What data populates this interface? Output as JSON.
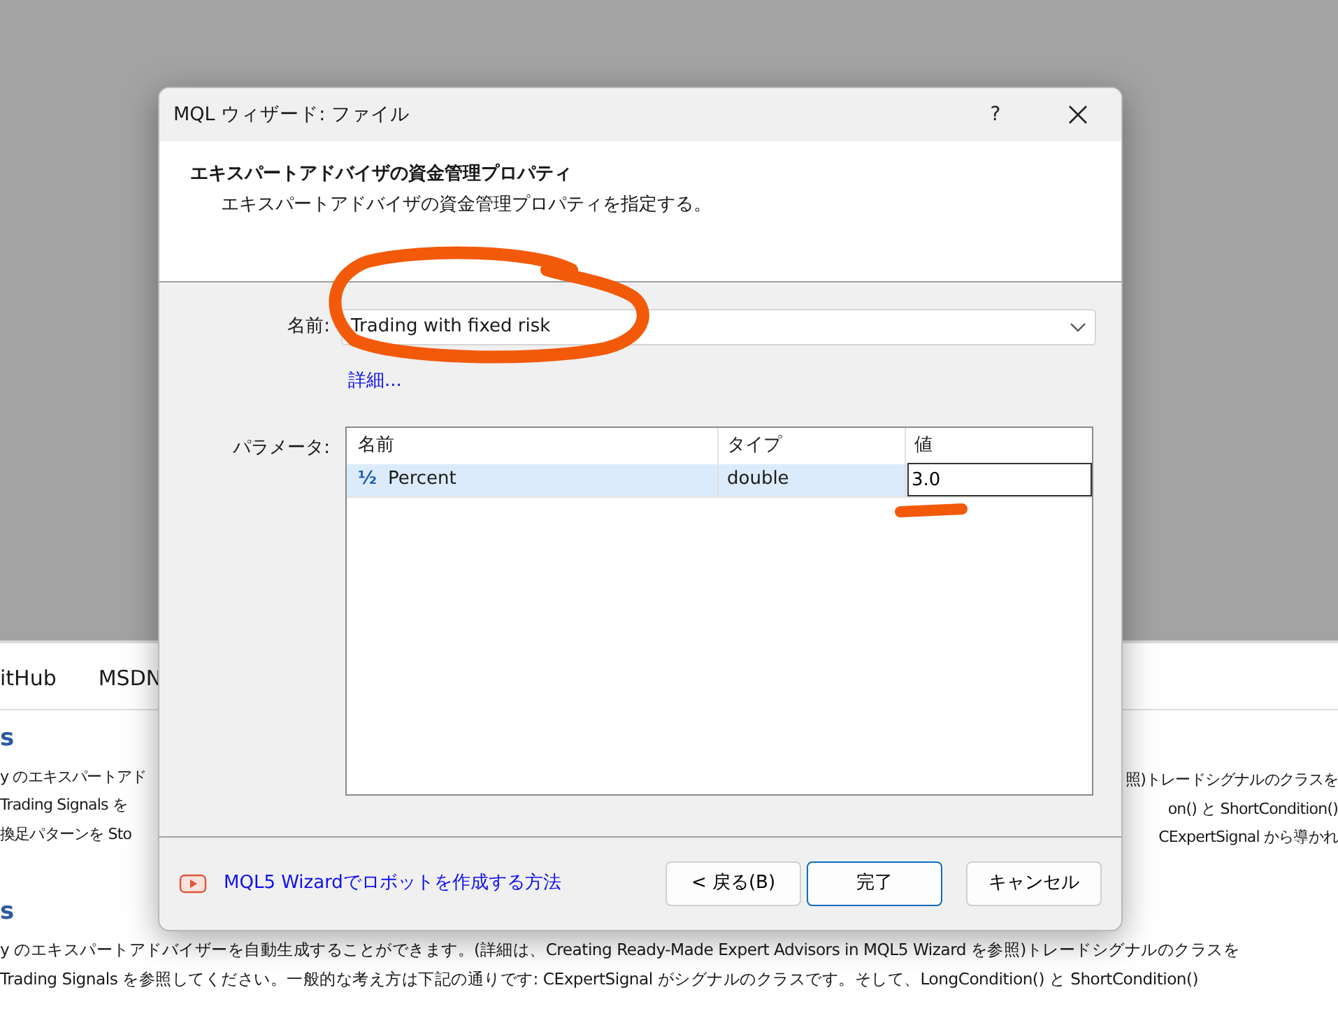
{
  "background_page": {
    "nav_links": [
      {
        "label": "itHub"
      },
      {
        "label": "MSDN"
      }
    ],
    "section_1": {
      "heading": "s",
      "lines_left": [
        "y のエキスパートアド",
        "Trading Signals を",
        "換足パターンを Sto"
      ],
      "lines_right": [
        "照)トレードシグナルのクラスを",
        "on() と ShortCondition()",
        "CExpertSignal から導かれ"
      ]
    },
    "section_2": {
      "heading": "s",
      "lines": [
        "y のエキスパートアドバイザーを自動生成することができます。(詳細は、Creating Ready-Made Expert Advisors in MQL5 Wizard を参照)トレードシグナルのクラスを",
        "Trading Signals を参照してください。一般的な考え方は下記の通りです: CExpertSignal がシグナルのクラスです。そして、LongCondition() と ShortCondition()"
      ]
    }
  },
  "dialog": {
    "title": "MQL ウィザード: ファイル",
    "help": "?",
    "header": {
      "title": "エキスパートアドバイザの資金管理プロパティ",
      "subtitle": "エキスパートアドバイザの資金管理プロパティを指定する。"
    },
    "name_field": {
      "label": "名前:",
      "value": "Trading with fixed risk"
    },
    "details_link": "詳細...",
    "parameters": {
      "label": "パラメータ:",
      "columns": [
        "名前",
        "タイプ",
        "値"
      ],
      "rows": [
        {
          "icon": "½",
          "name": "Percent",
          "type": "double",
          "value": "3.0",
          "selected": true,
          "editing": true
        }
      ]
    },
    "footer": {
      "link": "MQL5 Wizardでロボットを作成する方法",
      "buttons": [
        {
          "label": "< 戻る(B)",
          "default": false
        },
        {
          "label": "完了",
          "default": true
        },
        {
          "label": "キャンセル",
          "default": false
        }
      ]
    }
  }
}
